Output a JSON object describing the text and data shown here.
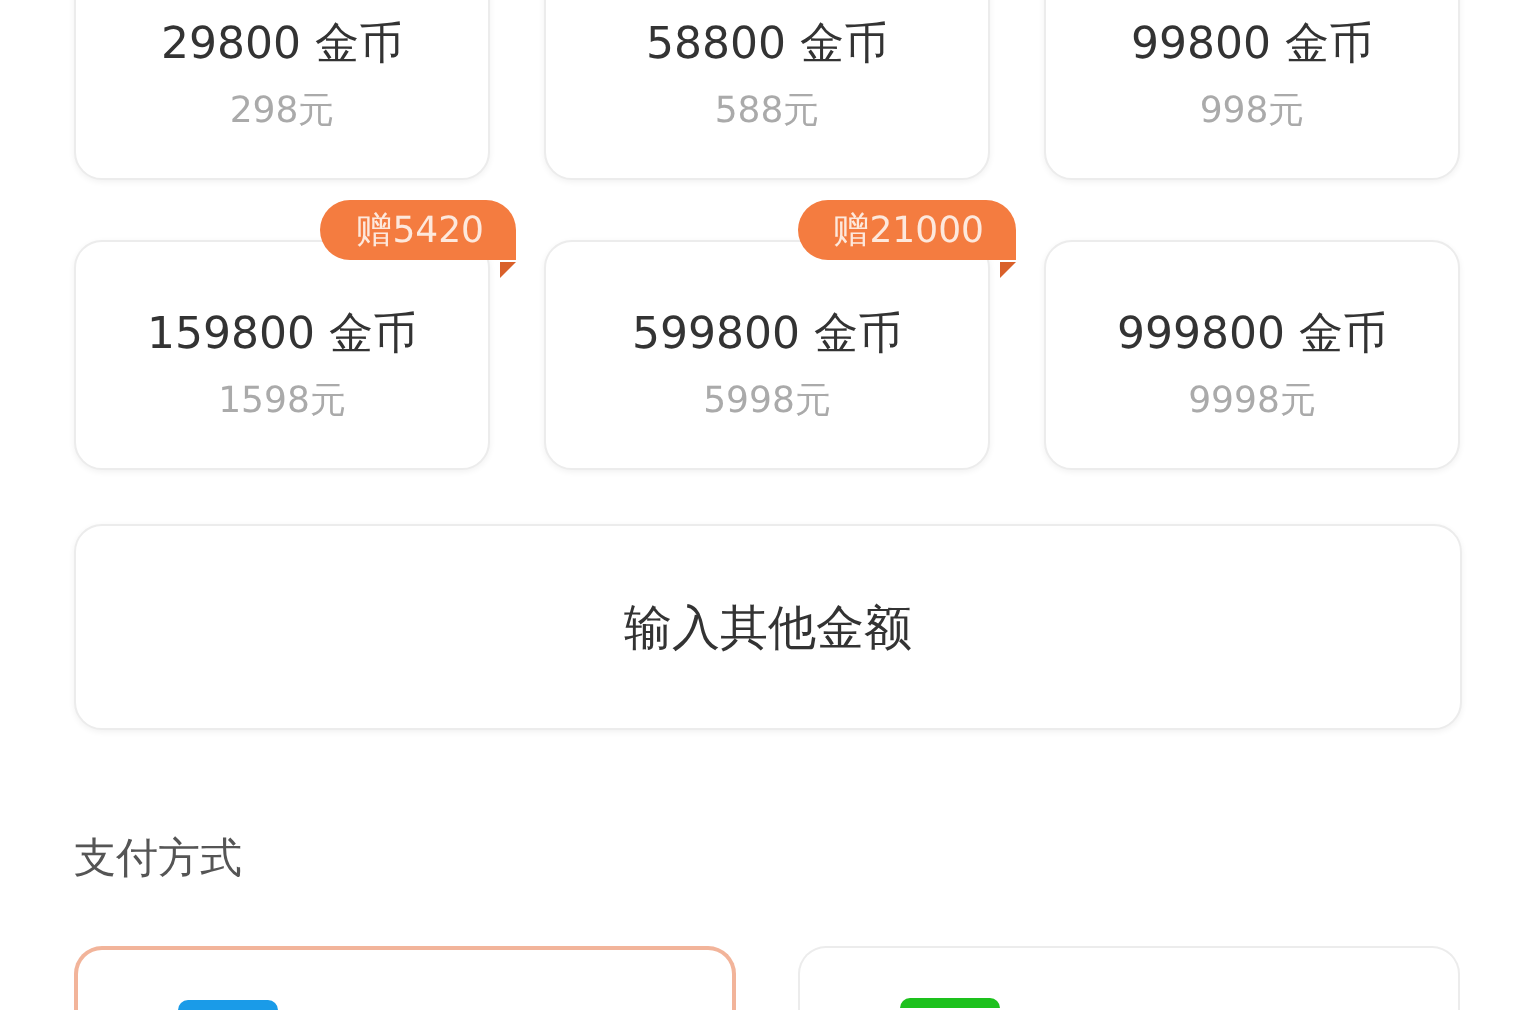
{
  "packages": [
    {
      "coins": "29800 金币",
      "price": "298元"
    },
    {
      "coins": "58800 金币",
      "price": "588元"
    },
    {
      "coins": "99800 金币",
      "price": "998元"
    },
    {
      "coins": "159800 金币",
      "price": "1598元",
      "badge": "赠5420"
    },
    {
      "coins": "599800 金币",
      "price": "5998元",
      "badge": "赠21000"
    },
    {
      "coins": "999800 金币",
      "price": "9998元"
    }
  ],
  "other_amount_button": "输入其他金额",
  "payment_section_title": "支付方式",
  "payment_methods": [
    {
      "selected": true,
      "color": "#1a9be8"
    },
    {
      "selected": false,
      "color": "#1dc11d"
    }
  ]
}
